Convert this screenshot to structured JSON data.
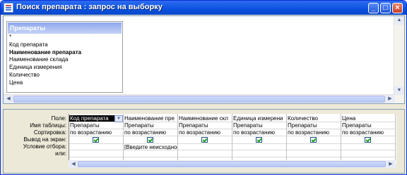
{
  "window": {
    "title": "Поиск препарата : запрос на выборку"
  },
  "table": {
    "name": "Препараты",
    "fields": [
      "*",
      "Код препарата",
      "Наименование препарата",
      "Наименование склада",
      "Единица измерения",
      "Количество",
      "Цена"
    ],
    "primary_key_index": 2
  },
  "grid": {
    "row_labels": [
      "Поле:",
      "Имя таблицы:",
      "Сортировка:",
      "Вывод на экран:",
      "Условие отбора:",
      "или:"
    ],
    "columns": [
      {
        "field": "Код препарата",
        "table": "Препараты",
        "sort": "по возрастанию",
        "show": true,
        "criteria": "",
        "selected": true
      },
      {
        "field": "Наименование пре",
        "table": "Препараты",
        "sort": "по возрастанию",
        "show": true,
        "criteria": "[Введите неисходнос"
      },
      {
        "field": "Наименование скл",
        "table": "Препараты",
        "sort": "по возрастанию",
        "show": true,
        "criteria": ""
      },
      {
        "field": "Единица измерени",
        "table": "Препараты",
        "sort": "по возрастанию",
        "show": true,
        "criteria": ""
      },
      {
        "field": "Количество",
        "table": "Препараты",
        "sort": "по возрастанию",
        "show": true,
        "criteria": ""
      },
      {
        "field": "Цена",
        "table": "Препараты",
        "sort": "по возрастанию",
        "show": true,
        "criteria": ""
      }
    ]
  },
  "icons": {
    "minimize": "minimize-icon",
    "maximize": "maximize-icon",
    "close": "close-icon"
  }
}
